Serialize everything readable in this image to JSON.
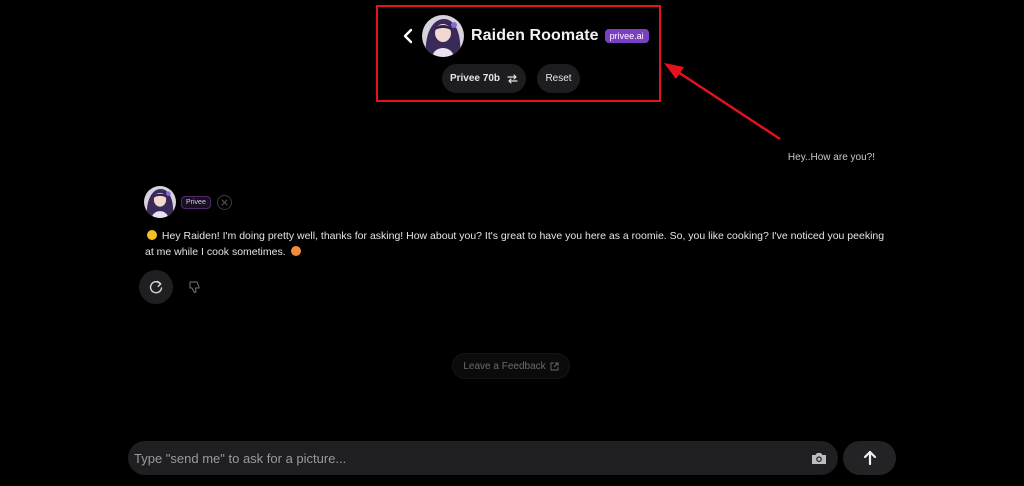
{
  "header": {
    "title": "Raiden Roomate",
    "brand_badge": "privee.ai",
    "model_button": "Privee 70b",
    "reset_button": "Reset"
  },
  "chat": {
    "user_message": "Hey..How are you?!",
    "bot_badge": "Privee",
    "bot_message": "Hey Raiden! I'm doing pretty well, thanks for asking! How about you? It's great to have you here as a roomie. So, you like cooking? I've noticed you peeking at me while I cook sometimes."
  },
  "feedback": {
    "label": "Leave a Feedback"
  },
  "composer": {
    "placeholder": "Type \"send me\" to ask for a picture..."
  },
  "colors": {
    "background": "#000000",
    "highlight": "#e3121d",
    "brand": "#7b3fc4",
    "pill": "#1d1d1f"
  },
  "icons": {
    "back": "chevron-left-icon",
    "switch": "swap-arrows-icon",
    "close": "close-icon",
    "regenerate": "refresh-icon",
    "dislike": "thumbs-down-icon",
    "external": "external-link-icon",
    "camera": "camera-icon",
    "send": "arrow-up-icon",
    "emoji_start": "grinning-face-icon",
    "emoji_end": "heart-eyes-icon"
  }
}
